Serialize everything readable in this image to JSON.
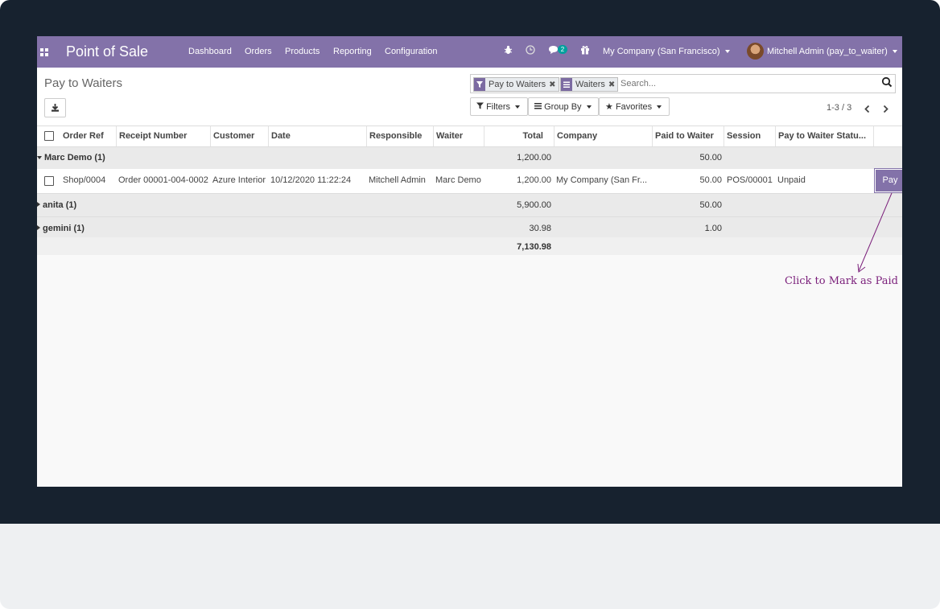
{
  "nav": {
    "brand": "Point of Sale",
    "menus": [
      "Dashboard",
      "Orders",
      "Products",
      "Reporting",
      "Configuration"
    ],
    "messages_count": "2",
    "company": "My Company (San Francisco)",
    "user": "Mitchell Admin (pay_to_waiter)"
  },
  "page": {
    "title": "Pay to Waiters"
  },
  "search": {
    "facets": [
      "Pay to Waiters",
      "Waiters"
    ],
    "placeholder": "Search...",
    "filters_label": "Filters",
    "groupby_label": "Group By",
    "favorites_label": "Favorites"
  },
  "pager": "1-3 / 3",
  "table": {
    "columns": [
      "Order Ref",
      "Receipt Number",
      "Customer",
      "Date",
      "Responsible",
      "Waiter",
      "Total",
      "Company",
      "Paid to Waiter",
      "Session",
      "Pay to Waiter Statu..."
    ],
    "groups": [
      {
        "label": "Marc Demo (1)",
        "total": "1,200.00",
        "paid": "50.00",
        "rows": [
          {
            "order_ref": "Shop/0004",
            "receipt": "Order 00001-004-0002",
            "customer": "Azure Interior",
            "date": "10/12/2020 11:22:24",
            "responsible": "Mitchell Admin",
            "waiter": "Marc Demo",
            "total": "1,200.00",
            "company": "My Company (San Fr...",
            "paid": "50.00",
            "session": "POS/00001",
            "status": "Unpaid",
            "action": "Pay"
          }
        ]
      },
      {
        "label": "anita (1)",
        "total": "5,900.00",
        "paid": "50.00"
      },
      {
        "label": "gemini (1)",
        "total": "30.98",
        "paid": "1.00"
      }
    ],
    "footer_total": "7,130.98"
  },
  "annotation": {
    "text": "Click to Mark as Paid",
    "color": "#7a1e7a"
  },
  "colors": {
    "brand": "#8372a9",
    "badge": "#00a09d",
    "frame": "#17222f"
  }
}
